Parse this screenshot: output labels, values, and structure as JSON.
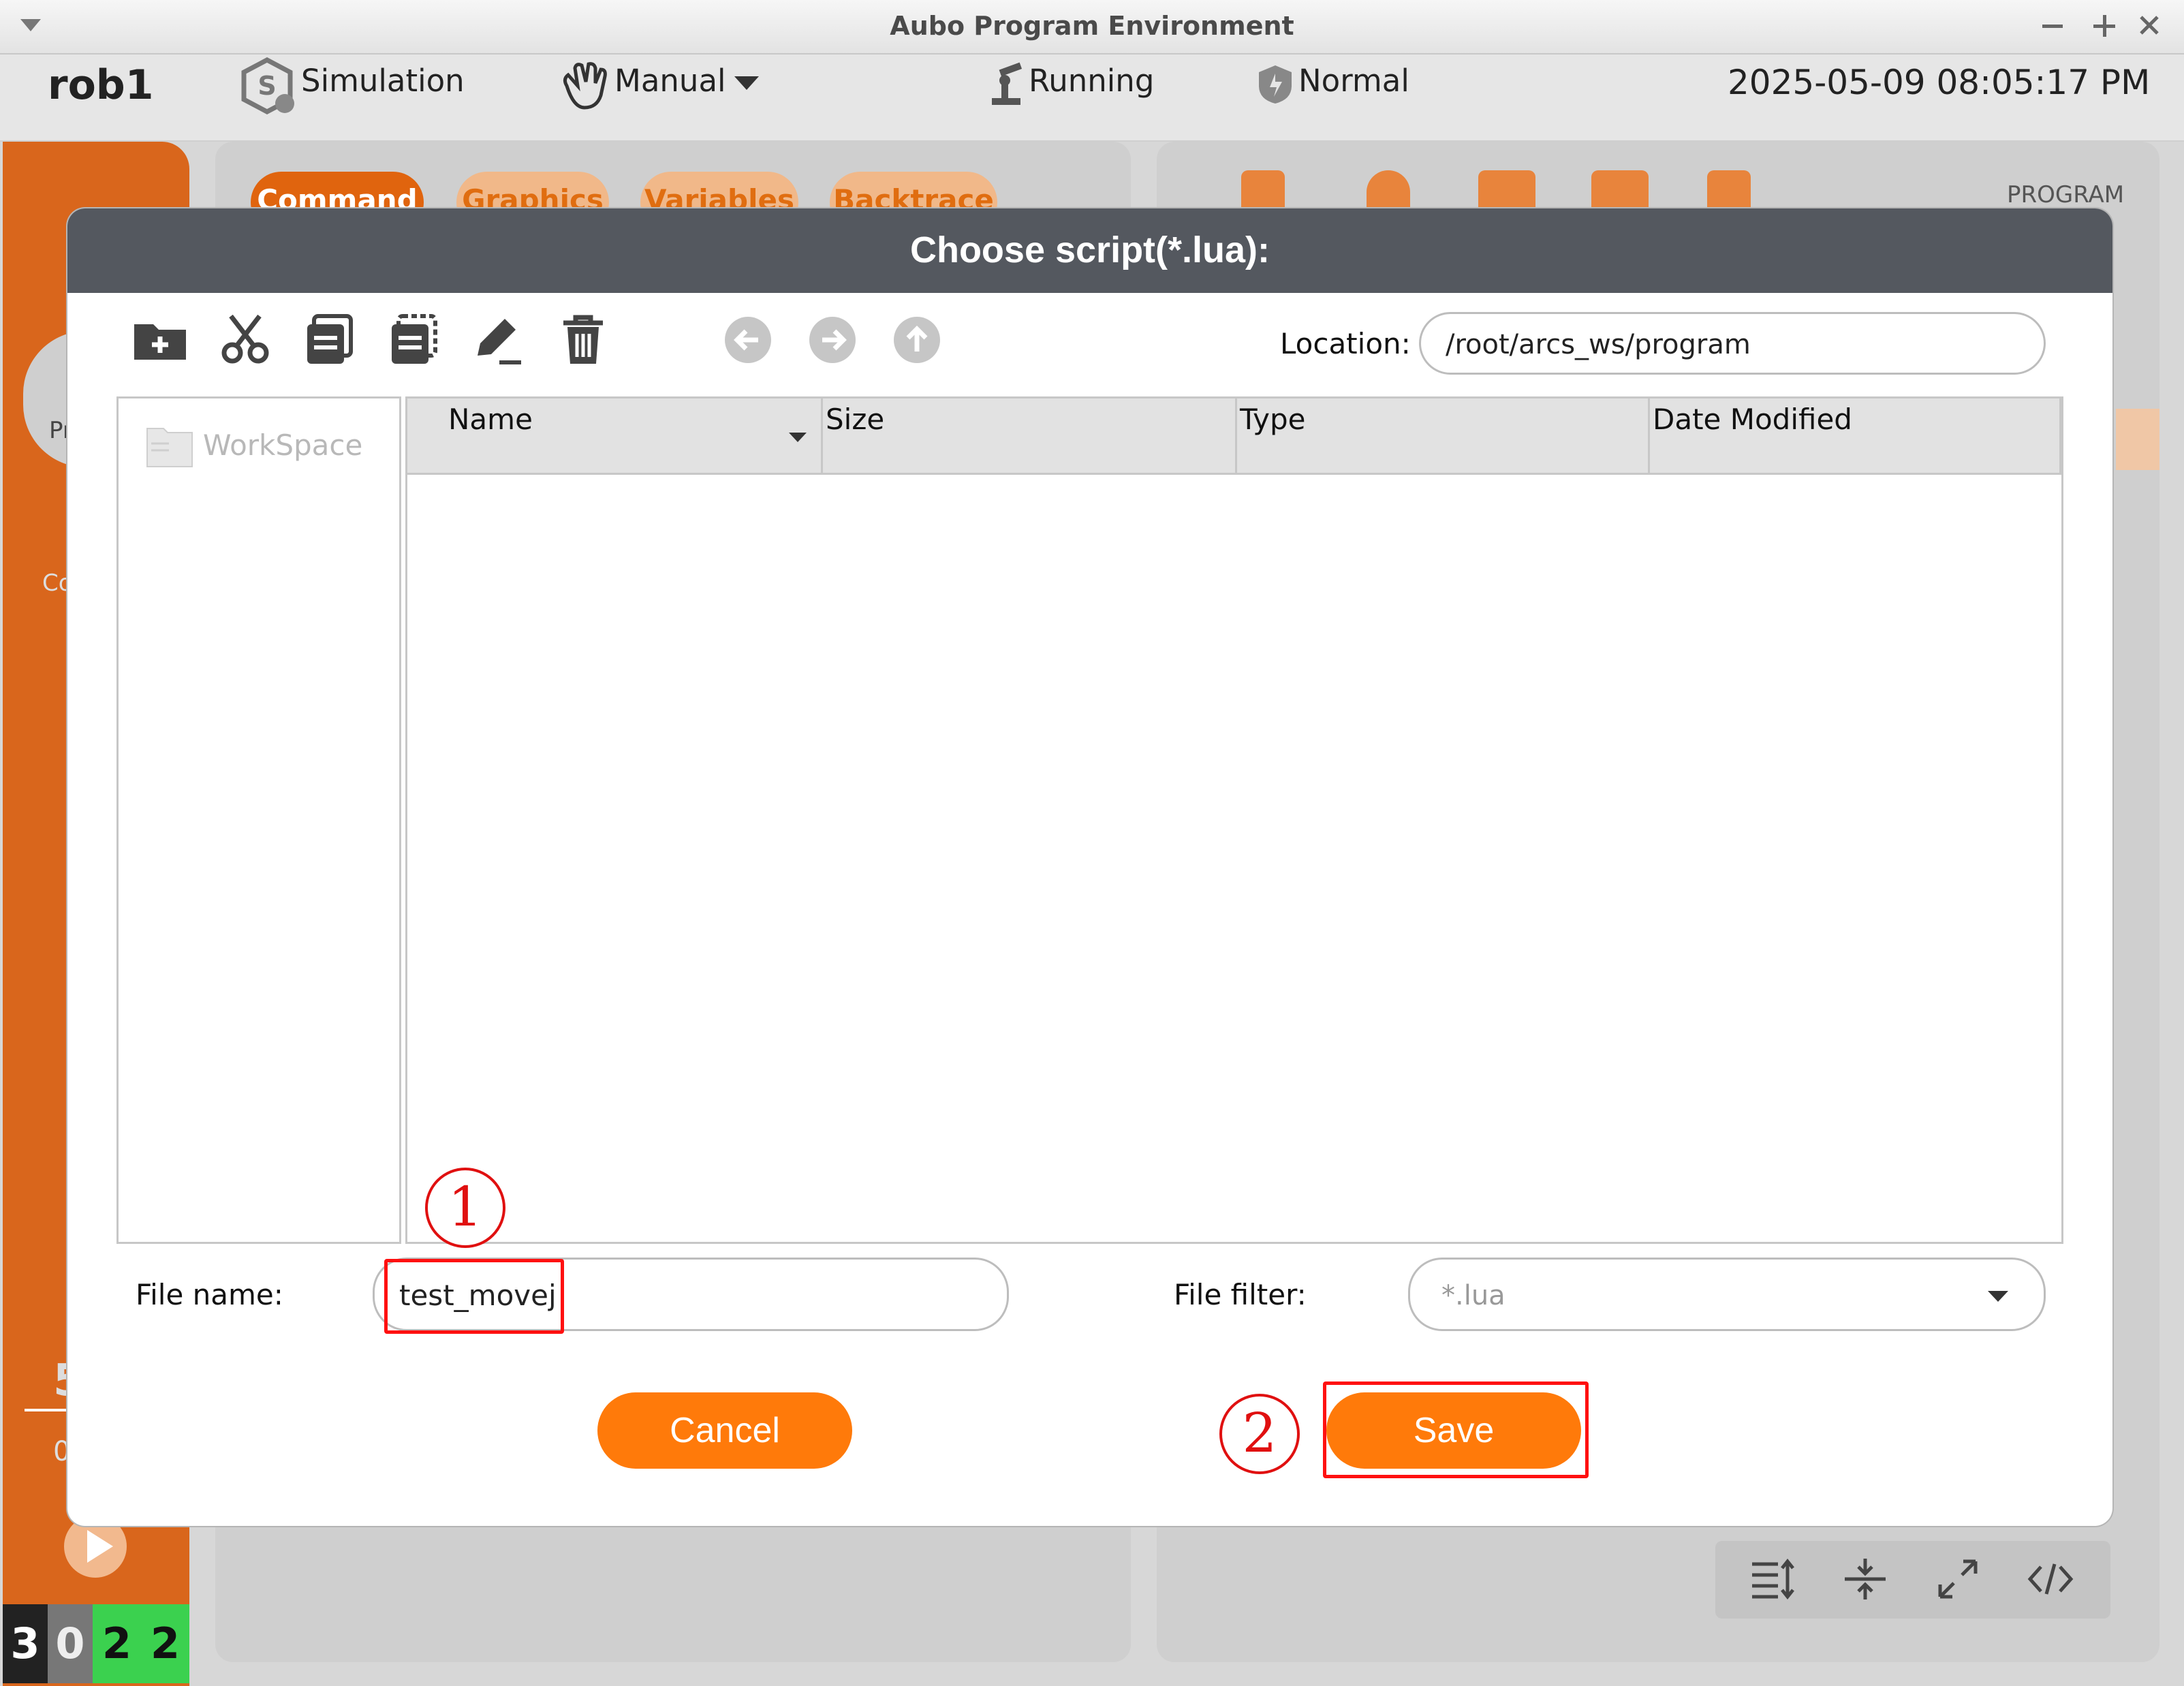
{
  "window": {
    "title": "Aubo Program Environment"
  },
  "status_bar": {
    "robot": "rob1",
    "mode": "Simulation",
    "control": "Manual",
    "run_state": "Running",
    "safety": "Normal",
    "datetime": "2025-05-09 08:05:17 PM"
  },
  "background": {
    "tabs": [
      "Command",
      "Graphics",
      "Variables",
      "Backtrace"
    ],
    "program_label": "PROGRAM",
    "counter_digits": [
      "3",
      "0",
      "2",
      "2"
    ],
    "sidebar_fragments": [
      "Pr",
      "Co",
      "5",
      "0"
    ]
  },
  "dialog": {
    "title": "Choose script(*.lua):",
    "location_label": "Location:",
    "location_value": "/root/arcs_ws/program",
    "places": [
      "WorkSpace"
    ],
    "columns": [
      "Name",
      "Size",
      "Type",
      "Date Modified"
    ],
    "file_name_label": "File name:",
    "file_name_value": "test_movej",
    "file_filter_label": "File filter:",
    "file_filter_value": "*.lua",
    "cancel_label": "Cancel",
    "save_label": "Save"
  },
  "annotations": {
    "step1": "1",
    "step2": "2",
    "color": "#ff1010"
  },
  "colors": {
    "accent": "#ff7a0a",
    "sidebar": "#d9661c",
    "dialog_header": "#54585f"
  }
}
